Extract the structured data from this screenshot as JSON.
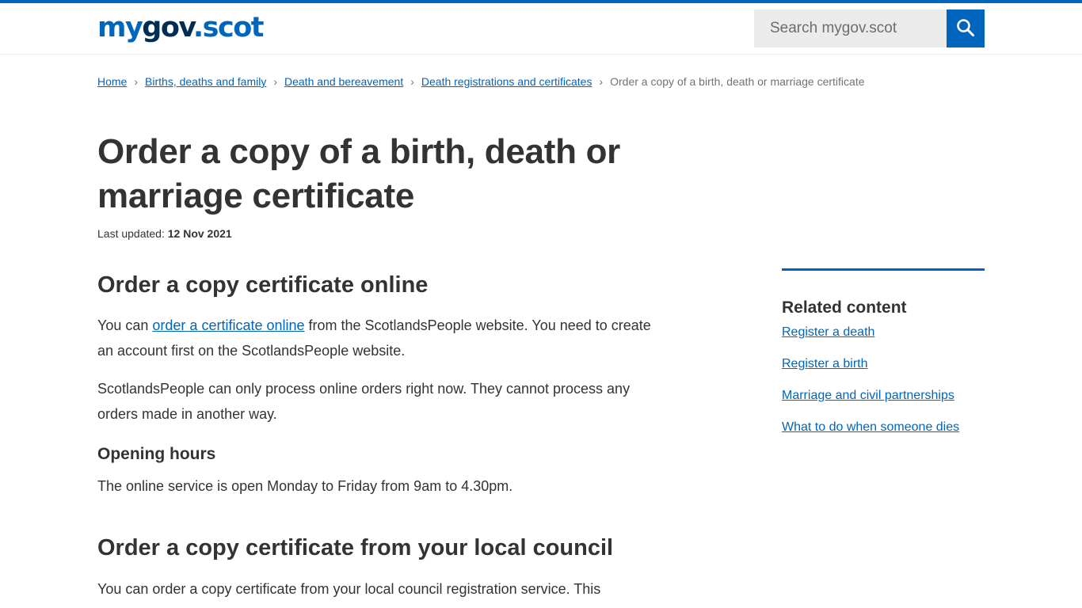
{
  "header": {
    "logo": {
      "part1": "my",
      "part2": "gov",
      "part3": ".scot"
    },
    "search": {
      "placeholder": "Search mygov.scot",
      "value": "",
      "button_icon": "search-icon"
    },
    "brand_color": "#0065bd"
  },
  "breadcrumb": {
    "items": [
      {
        "label": "Home"
      },
      {
        "label": "Births, deaths and family"
      },
      {
        "label": "Death and bereavement"
      },
      {
        "label": "Death registrations and certificates"
      }
    ],
    "current": "Order a copy of a birth, death or marriage certificate",
    "separator": "›"
  },
  "page": {
    "title": "Order a copy of a birth, death or marriage certificate",
    "last_updated_label": "Last updated:",
    "last_updated_value": "12 Nov 2021"
  },
  "main": {
    "section1": {
      "heading": "Order a copy certificate online",
      "p1_before": "You can ",
      "p1_link": "order a certificate online",
      "p1_after": " from the ScotlandsPeople website. You need to create an account first on the ScotlandsPeople website.",
      "p2": "ScotlandsPeople can only process online orders right now. They cannot process any orders made in another way.",
      "subheading": "Opening hours",
      "p3": "The online service is open Monday to Friday from 9am to 4.30pm."
    },
    "section2": {
      "heading": "Order a copy certificate from your local council",
      "p1": "You can order a copy certificate from your local council registration service. This"
    }
  },
  "aside": {
    "heading": "Related content",
    "links": [
      {
        "label": "Register a death"
      },
      {
        "label": "Register a birth"
      },
      {
        "label": "Marriage and civil partnerships"
      },
      {
        "label": "What to do when someone dies"
      }
    ]
  }
}
